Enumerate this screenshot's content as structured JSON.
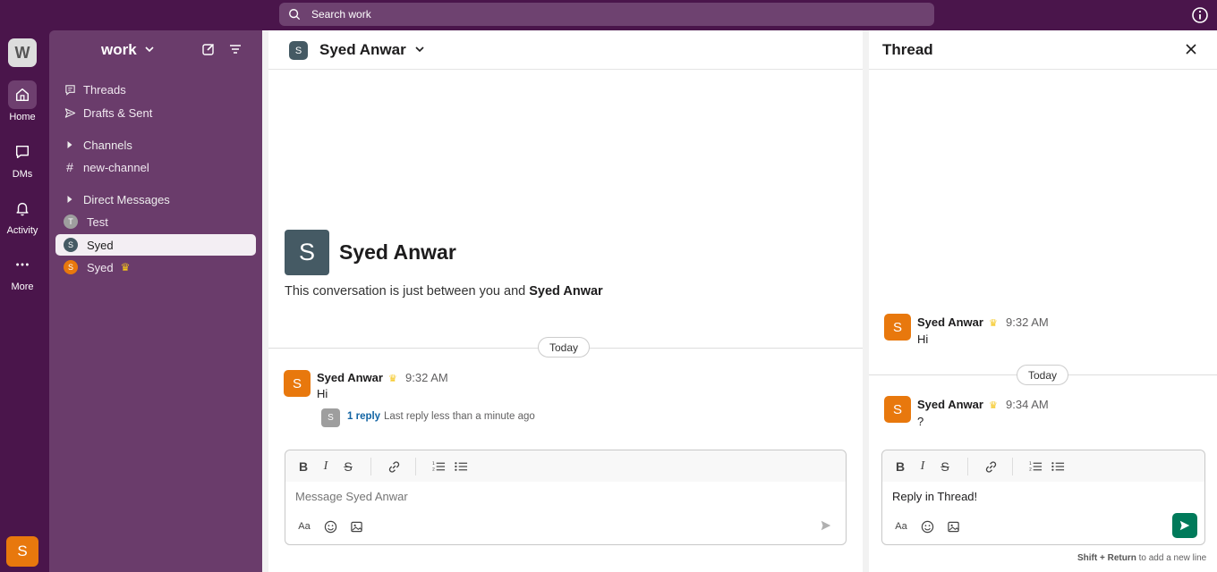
{
  "topbar": {
    "search_placeholder": "Search work"
  },
  "rail": {
    "workspace_initial": "W",
    "items": [
      {
        "label": "Home",
        "icon": "home-icon"
      },
      {
        "label": "DMs",
        "icon": "chat-icon"
      },
      {
        "label": "Activity",
        "icon": "bell-icon"
      },
      {
        "label": "More",
        "icon": "more-icon"
      }
    ],
    "user_initial": "S"
  },
  "sidebar": {
    "workspace_name": "work",
    "threads_label": "Threads",
    "drafts_label": "Drafts & Sent",
    "channels_label": "Channels",
    "channel_items": [
      {
        "label": "new-channel"
      }
    ],
    "dm_label": "Direct Messages",
    "dm_items": [
      {
        "initial": "T",
        "label": "Test",
        "color": "#9e9e9e"
      },
      {
        "initial": "S",
        "label": "Syed",
        "color": "#455a64"
      },
      {
        "initial": "S",
        "label": "Syed",
        "color": "#e8780d"
      }
    ]
  },
  "main": {
    "header_initial": "S",
    "header_name": "Syed Anwar",
    "intro_initial": "S",
    "intro_name": "Syed Anwar",
    "intro_text": "This conversation is just between you and ",
    "intro_name_bold": "Syed Anwar",
    "date_pill": "Today",
    "message": {
      "initial": "S",
      "author": "Syed Anwar",
      "time": "9:32 AM",
      "text": "Hi",
      "reply_initial": "S",
      "reply_count": "1 reply",
      "reply_meta": "Last reply less than a minute ago"
    },
    "composer_placeholder": "Message Syed Anwar"
  },
  "thread": {
    "title": "Thread",
    "parent": {
      "initial": "S",
      "author": "Syed Anwar",
      "time": "9:32 AM",
      "text": "Hi"
    },
    "date_pill": "Today",
    "reply": {
      "initial": "S",
      "author": "Syed Anwar",
      "time": "9:34 AM",
      "text": "?"
    },
    "composer_value": "Reply in Thread!",
    "hint_bold": "Shift + Return",
    "hint_rest": " to add a new line"
  },
  "colors": {
    "aubergine": "#4a154b",
    "sidebar": "#6a3c6b",
    "send_green": "#007a5a",
    "link_blue": "#1264a3",
    "avatar_orange": "#e8780d"
  }
}
